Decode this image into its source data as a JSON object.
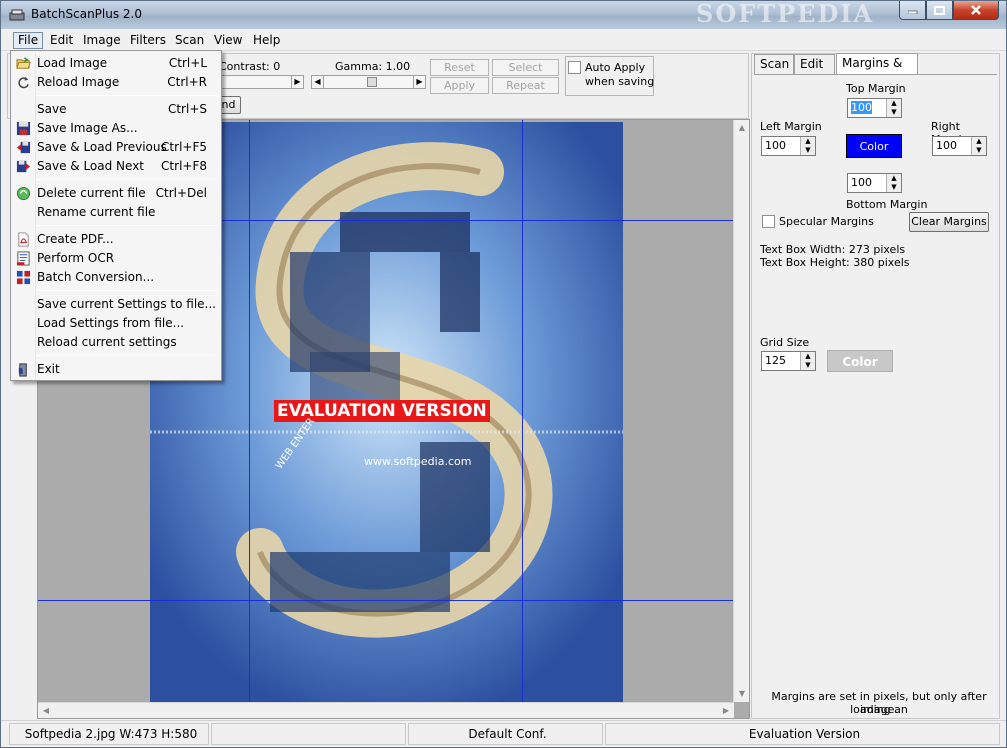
{
  "window": {
    "title": "BatchScanPlus 2.0",
    "watermark": "SOFTPEDIA"
  },
  "menubar": [
    "File",
    "Edit",
    "Image",
    "Filters",
    "Scan",
    "View",
    "Help"
  ],
  "file_menu": {
    "items": [
      {
        "label": "Load Image",
        "shortcut": "Ctrl+L",
        "icon": "folder-open-icon"
      },
      {
        "label": "Reload Image",
        "shortcut": "Ctrl+R",
        "icon": "reload-icon"
      },
      {
        "label": "Save",
        "shortcut": "Ctrl+S",
        "icon": ""
      },
      {
        "label": "Save Image As...",
        "shortcut": "",
        "icon": "floppy-icon"
      },
      {
        "label": "Save & Load Previous",
        "shortcut": "Ctrl+F5",
        "icon": "save-previous-icon"
      },
      {
        "label": "Save & Load Next",
        "shortcut": "Ctrl+F8",
        "icon": "save-next-icon"
      },
      {
        "label": "Delete current file",
        "shortcut": "Ctrl+Del",
        "icon": "recycle-icon"
      },
      {
        "label": "Rename current file",
        "shortcut": "",
        "icon": ""
      },
      {
        "label": "Create PDF...",
        "shortcut": "",
        "icon": "pdf-icon"
      },
      {
        "label": "Perform OCR",
        "shortcut": "",
        "icon": "ocr-icon"
      },
      {
        "label": "Batch Conversion...",
        "shortcut": "",
        "icon": "batch-icon"
      },
      {
        "label": "Save current Settings to file...",
        "shortcut": "",
        "icon": ""
      },
      {
        "label": "Load Settings from file...",
        "shortcut": "",
        "icon": ""
      },
      {
        "label": "Reload current settings",
        "shortcut": "",
        "icon": ""
      },
      {
        "label": "Exit",
        "shortcut": "",
        "icon": "exit-icon"
      }
    ]
  },
  "toolbar": {
    "contrast_label": "Contrast: 0",
    "gamma_label": "Gamma: 1.00",
    "reset": "Reset",
    "select": "Select",
    "apply": "Apply",
    "repeat": "Repeat",
    "auto_apply": "Auto Apply",
    "when_saving": "when saving",
    "partial_button": "nd"
  },
  "image": {
    "overlay_text": "EVALUATION VERSION",
    "site_text": "www.softpedia.com",
    "web_text": "WEB  ENTER"
  },
  "right_panel": {
    "tabs": [
      "Scan",
      "Edit",
      "Margins & Grid"
    ],
    "active_tab": 2,
    "top_margin_label": "Top Margin",
    "top_margin": "100",
    "left_margin_label": "Left Margin",
    "left_margin": "100",
    "right_margin_label": "Right Margin",
    "right_margin": "100",
    "bottom_margin_label": "Bottom Margin",
    "bottom_margin": "100",
    "color_label": "Color",
    "specular_margins": "Specular Margins",
    "clear_margins": "Clear Margins",
    "text_box_width": "Text Box Width: 273 pixels",
    "text_box_height": "Text Box Height: 380 pixels",
    "grid_size_label": "Grid Size",
    "grid_size": "125",
    "grid_color_label": "Color",
    "note_line1": "Margins are set in pixels, but only after loading an",
    "note_line2": "image.",
    "colors": {
      "margin_color": "#0000ff",
      "grid_color": "#c8c8c8"
    }
  },
  "statusbar": {
    "file_info": "Softpedia 2.jpg W:473 H:580",
    "config": "Default Conf.",
    "version": "Evaluation Version"
  }
}
